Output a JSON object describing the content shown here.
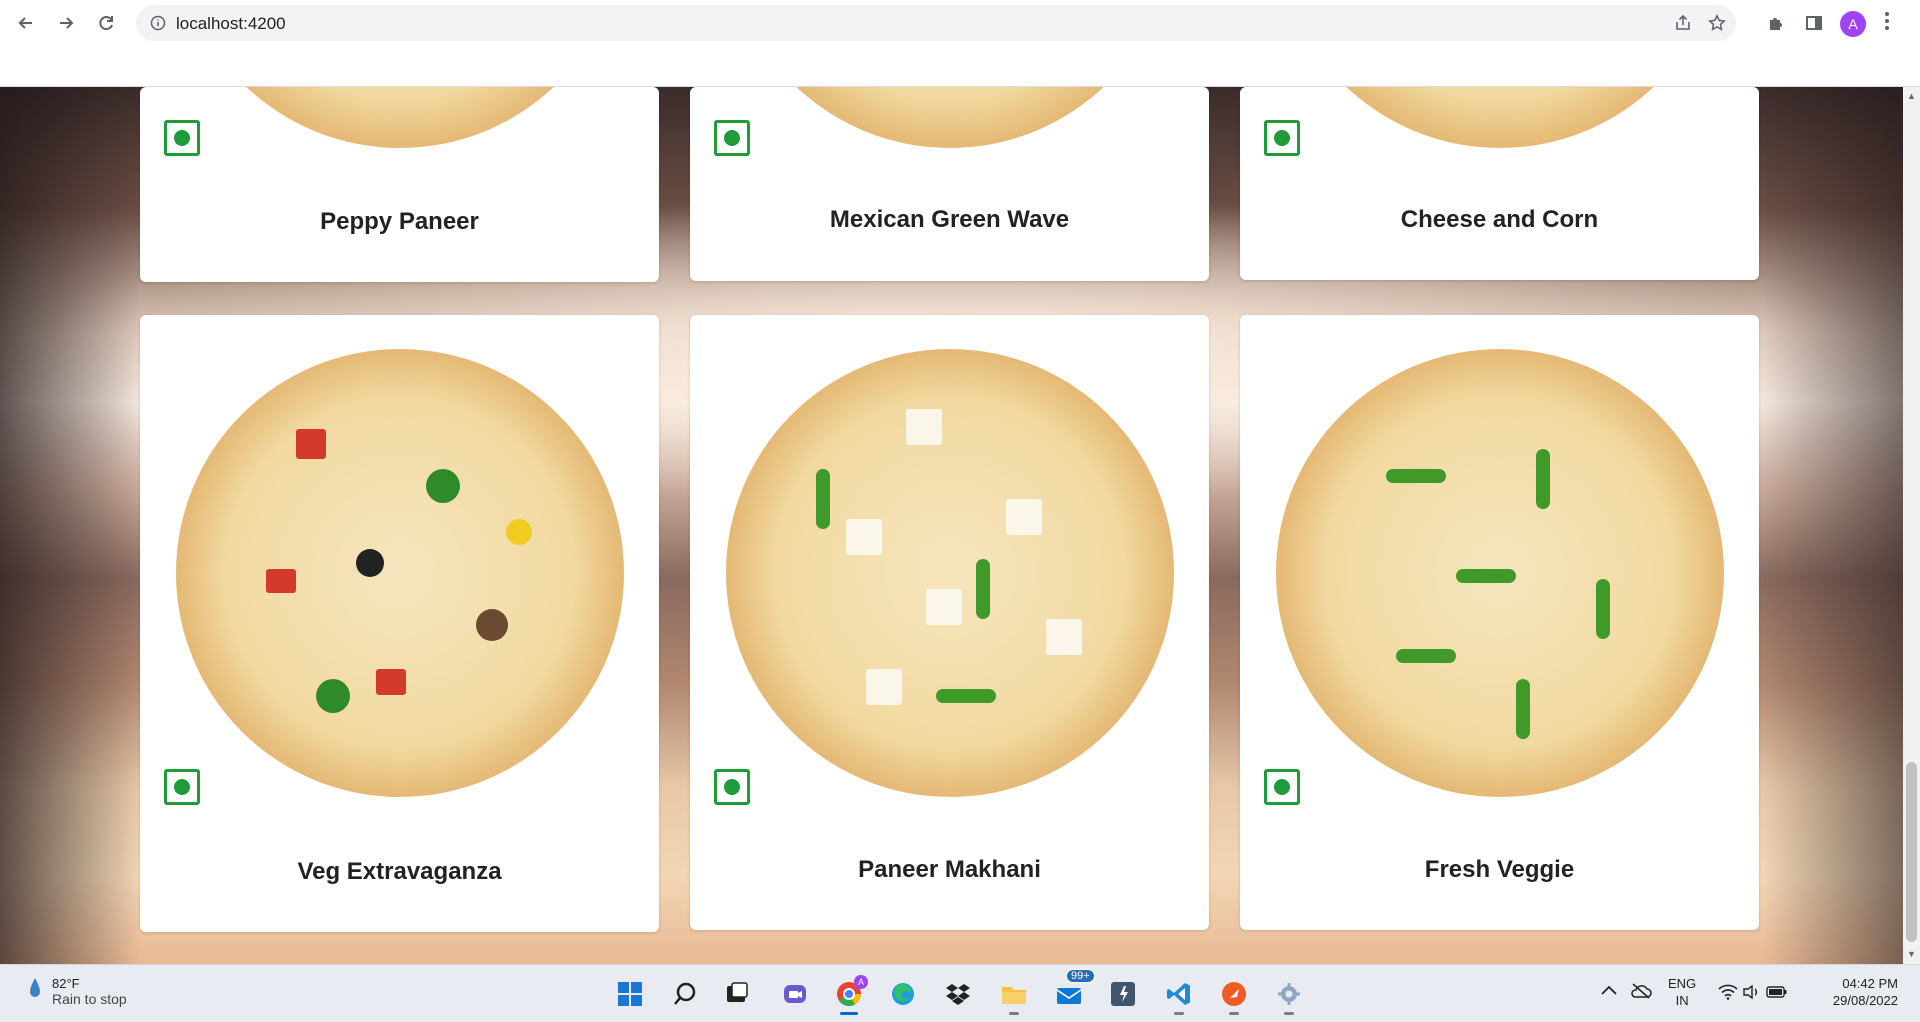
{
  "browser": {
    "url": "localhost:4200",
    "avatar_letter": "A"
  },
  "cards": [
    {
      "name": "Peppy Paneer"
    },
    {
      "name": "Mexican Green Wave"
    },
    {
      "name": "Cheese and Corn"
    },
    {
      "name": "Veg Extravaganza"
    },
    {
      "name": "Paneer Makhani"
    },
    {
      "name": "Fresh Veggie"
    }
  ],
  "taskbar": {
    "weather_temp": "82°F",
    "weather_desc": "Rain to stop",
    "mail_badge": "99+",
    "lang_top": "ENG",
    "lang_bottom": "IN",
    "time": "04:42 PM",
    "date": "29/08/2022"
  },
  "colors": {
    "veg_mark": "#1f9b3a",
    "avatar_bg": "#a142f4"
  }
}
